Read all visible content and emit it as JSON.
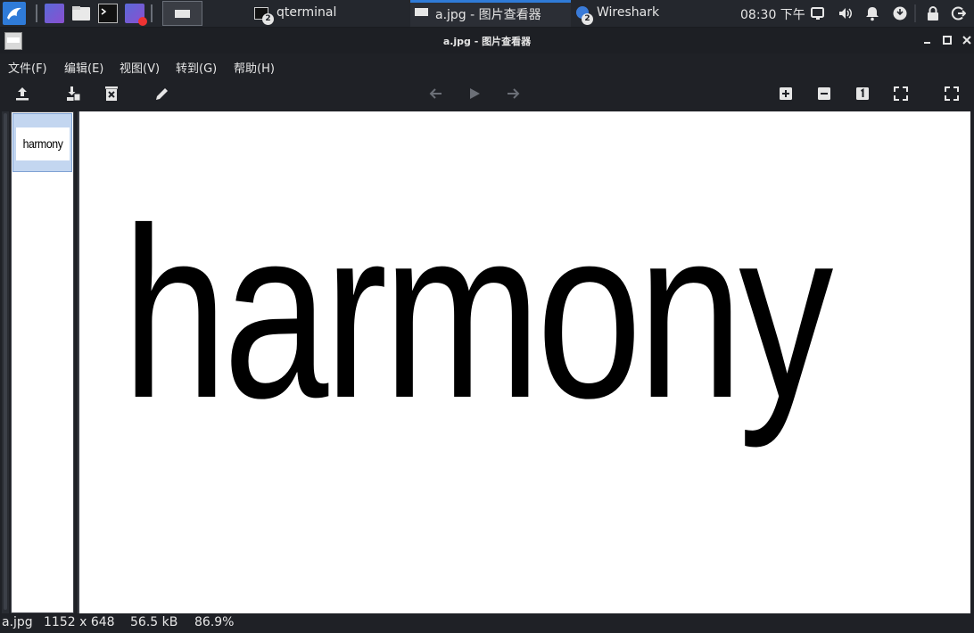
{
  "taskbar": {
    "windows": [
      {
        "label": "qterminal",
        "count": "2"
      },
      {
        "label": "a.jpg - 图片查看器"
      },
      {
        "label": "Wireshark",
        "count": "2"
      }
    ],
    "clock": "08:30 下午",
    "accent": "#2f7bd8"
  },
  "window": {
    "title": "a.jpg - 图片查看器"
  },
  "menu": [
    "文件(F)",
    "编辑(E)",
    "视图(V)",
    "转到(G)",
    "帮助(H)"
  ],
  "toolbar": {
    "icons": [
      "upload-icon",
      "save-as-icon",
      "delete-icon",
      "edit-icon",
      "back-arrow-icon",
      "play-icon",
      "forward-arrow-icon",
      "zoom-in-icon",
      "zoom-out-icon",
      "original-size-icon",
      "fit-icon",
      "fullscreen-icon"
    ]
  },
  "thumbnail": {
    "text": "harmony"
  },
  "image": {
    "text": "harmony"
  },
  "status": {
    "filename": "a.jpg",
    "dimensions": "1152 x 648",
    "size": "56.5 kB",
    "zoom": "86.9%"
  }
}
